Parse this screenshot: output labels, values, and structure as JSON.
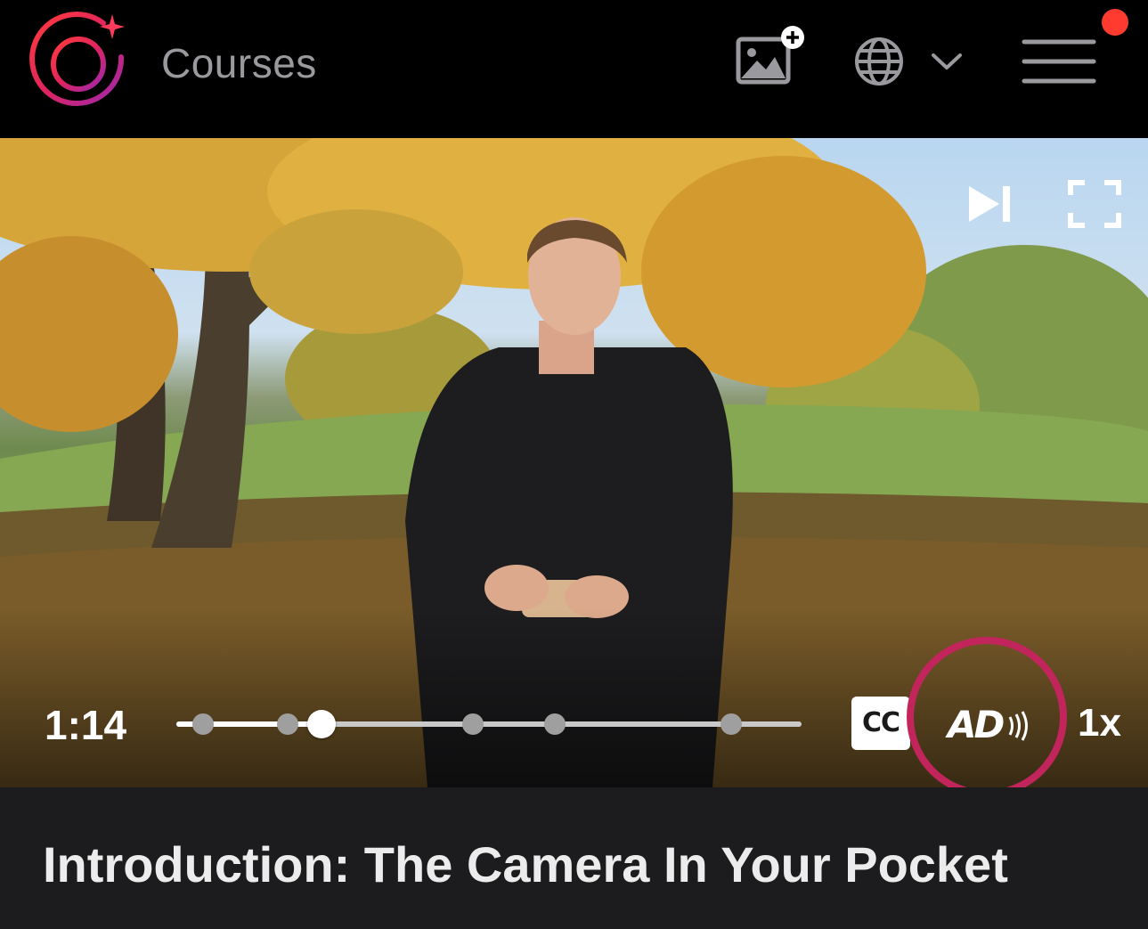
{
  "header": {
    "brand": "Courses",
    "icons": [
      "logo-ring-sparkle-icon",
      "add-image-icon",
      "globe-icon",
      "chevron-down-icon",
      "hamburger-menu-icon"
    ],
    "notification_badge_color": "#ff3b30"
  },
  "player": {
    "current_time": "1:14",
    "progress": 0.232,
    "chapter_markers": [
      0.043,
      0.178,
      0.475,
      0.605,
      0.888
    ],
    "controls": {
      "captions_label": "CC",
      "audio_description_label": "AD",
      "speed_label": "1x",
      "next_icon": "skip-next-icon",
      "fullscreen_icon": "fullscreen-icon"
    },
    "highlight_color": "#c2255c"
  },
  "lesson": {
    "title": "Introduction: The Camera In Your Pocket"
  }
}
